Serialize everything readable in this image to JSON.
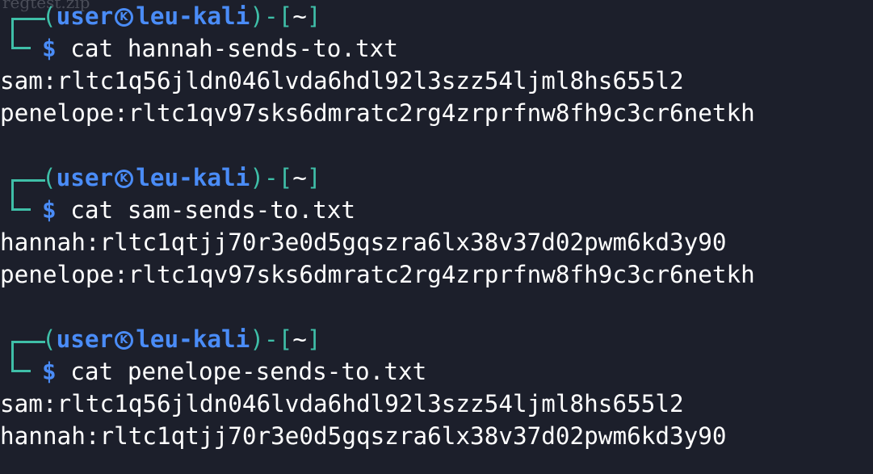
{
  "ghost_text": "regtest.zip",
  "prompt": {
    "user": "user",
    "host": "leu-kali",
    "dir": "~",
    "symbol": "$"
  },
  "sessions": [
    {
      "command": "cat hannah-sends-to.txt",
      "output": [
        "sam:rltc1q56jldn046lvda6hdl92l3szz54ljml8hs655l2",
        "penelope:rltc1qv97sks6dmratc2rg4zrprfnw8fh9c3cr6netkh"
      ]
    },
    {
      "command": "cat sam-sends-to.txt",
      "output": [
        "hannah:rltc1qtjj70r3e0d5gqszra6lx38v37d02pwm6kd3y90",
        "penelope:rltc1qv97sks6dmratc2rg4zrprfnw8fh9c3cr6netkh"
      ]
    },
    {
      "command": "cat penelope-sends-to.txt",
      "output": [
        "sam:rltc1q56jldn046lvda6hdl92l3szz54ljml8hs655l2",
        "hannah:rltc1qtjj70r3e0d5gqszra6lx38v37d02pwm6kd3y90"
      ]
    }
  ]
}
